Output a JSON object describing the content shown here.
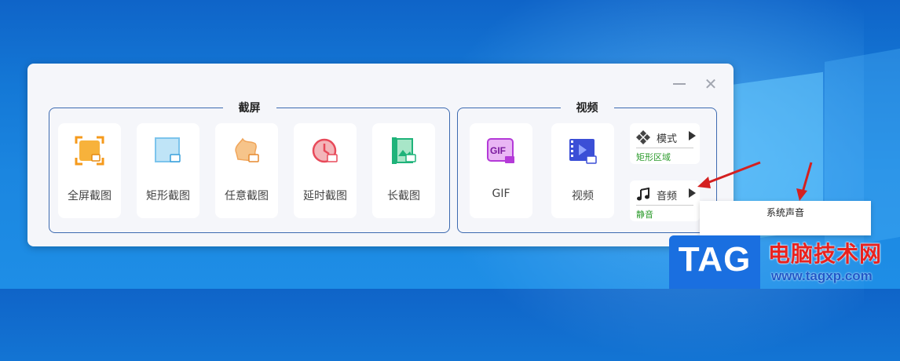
{
  "window": {
    "minimize_label": "—",
    "close_label": "✕"
  },
  "screenshot_group": {
    "title": "截屏",
    "tiles": [
      {
        "label": "全屏截图",
        "icon": "fullscreen-capture-icon"
      },
      {
        "label": "矩形截图",
        "icon": "rectangle-capture-icon"
      },
      {
        "label": "任意截图",
        "icon": "freeform-capture-icon"
      },
      {
        "label": "延时截图",
        "icon": "delayed-capture-icon"
      },
      {
        "label": "长截图",
        "icon": "long-capture-icon"
      }
    ]
  },
  "video_group": {
    "title": "视频",
    "tiles": [
      {
        "label": "GIF",
        "icon": "gif-icon",
        "icon_text": "GIF"
      },
      {
        "label": "视频",
        "icon": "video-icon"
      }
    ],
    "mode": {
      "label": "模式",
      "value": "矩形区域",
      "icon": "mode-icon"
    },
    "audio": {
      "label": "音频",
      "value": "静音",
      "icon": "music-note-icon"
    }
  },
  "audio_menu": {
    "items": [
      "系统声音"
    ]
  },
  "watermark": {
    "logo_text": "TAG",
    "site_name": "电脑技术网",
    "url": "www.tagxp.com"
  },
  "colors": {
    "accent_green": "#2a9a2a",
    "border_blue": "#3d6ab0",
    "annotation_red": "#d42020"
  }
}
